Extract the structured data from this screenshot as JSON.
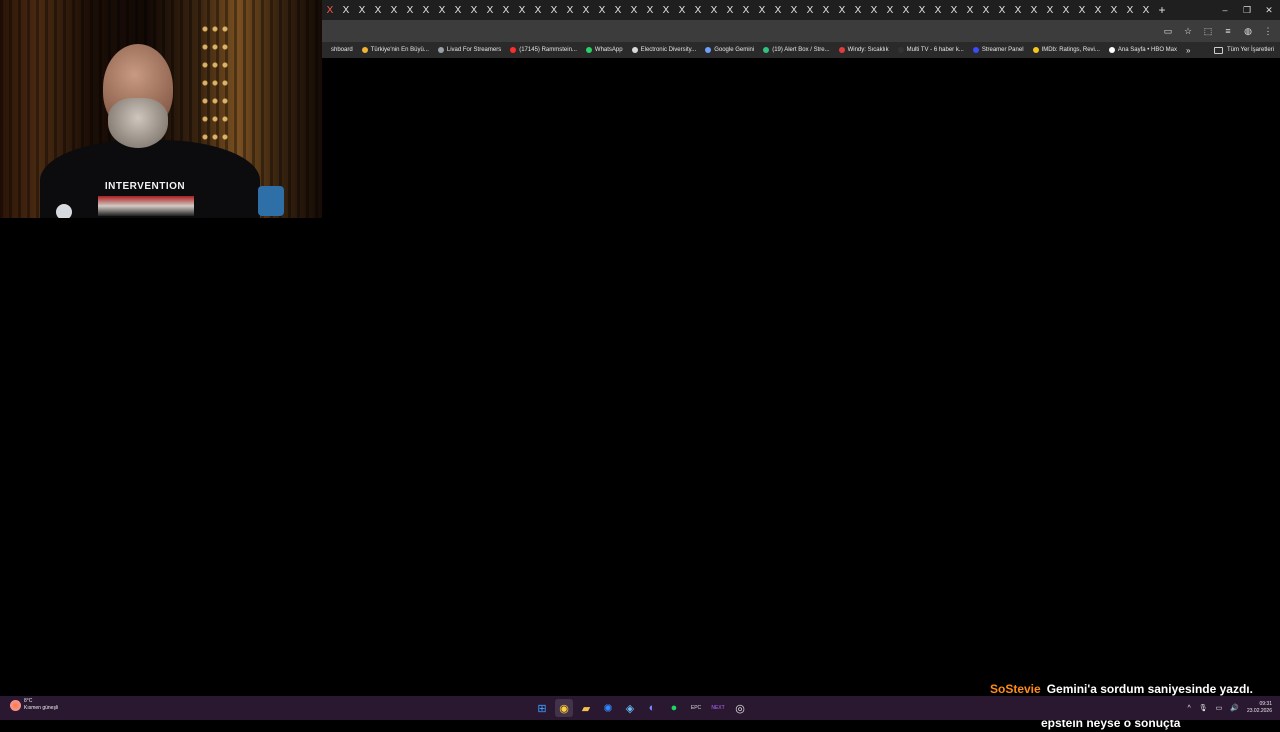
{
  "browser": {
    "tab_glyph": "X",
    "tab_count": 52,
    "new_tab": "+",
    "window_controls": [
      "–",
      "❐",
      "✕"
    ]
  },
  "toolbar": {
    "icons": [
      "cast-icon",
      "star-icon",
      "extensions-icon",
      "media-icon",
      "profile-icon",
      "menu-icon"
    ]
  },
  "bookmarks": {
    "items": [
      {
        "label": "shboard",
        "color": "#2a2a2a"
      },
      {
        "label": "Türkiye'nin En Büyü...",
        "color": "#f2b233"
      },
      {
        "label": "Livad For Streamers",
        "color": "#9aa0a6"
      },
      {
        "label": "(17145) Rammstein...",
        "color": "#ff2d2d"
      },
      {
        "label": "WhatsApp",
        "color": "#25d366"
      },
      {
        "label": "Electronic Diversity...",
        "color": "#d9d9d9"
      },
      {
        "label": "Google Gemini",
        "color": "#6ea0ff"
      },
      {
        "label": "(19) Alert Box / Stre...",
        "color": "#31c27c"
      },
      {
        "label": "Windy: Sıcaklık",
        "color": "#e23b3b"
      },
      {
        "label": "Multi TV - 6 haber k...",
        "color": "#333333"
      },
      {
        "label": "Streamer Panel",
        "color": "#3b4cff"
      },
      {
        "label": "IMDb: Ratings, Revi...",
        "color": "#f5c518"
      },
      {
        "label": "Ana Sayfa • HBO Max",
        "color": "#ffffff"
      }
    ],
    "more": "»",
    "all_bookmarks": "Tüm Yer İşaretleri"
  },
  "webcam": {
    "shirt_text": "INTERVENTION"
  },
  "chat": {
    "username": "SoStevie",
    "line1": "Gemini'a sordum saniyesinde yazdı. Ama AI da",
    "line2": "epstein neyse o sonuçta"
  },
  "taskbar": {
    "weather_temp": "8°C",
    "weather_desc": "Kısmen güneşli",
    "apps": [
      {
        "name": "start-icon",
        "glyph": "⊞",
        "color": "#3aa0ff"
      },
      {
        "name": "chrome-icon",
        "glyph": "◉",
        "color": "#ffcf3a"
      },
      {
        "name": "file-explorer-icon",
        "glyph": "▰",
        "color": "#f2c14e"
      },
      {
        "name": "battlenet-icon",
        "glyph": "✺",
        "color": "#2f8cff"
      },
      {
        "name": "steam-icon",
        "glyph": "◈",
        "color": "#66c0f4"
      },
      {
        "name": "discord-icon",
        "glyph": "◐",
        "color": "#7b86ff"
      },
      {
        "name": "spotify-icon",
        "glyph": "●",
        "color": "#1ed760"
      },
      {
        "name": "epic-games-icon",
        "glyph": "EPC",
        "color": "#dddddd"
      },
      {
        "name": "kick-icon",
        "glyph": "NEXT",
        "color": "#b06cff"
      },
      {
        "name": "obs-icon",
        "glyph": "◎",
        "color": "#e6e6e6"
      }
    ],
    "tray_icons": [
      "^",
      "🎙",
      "▭",
      "🔊"
    ],
    "time": "09:31",
    "date": "23.02.2026"
  }
}
